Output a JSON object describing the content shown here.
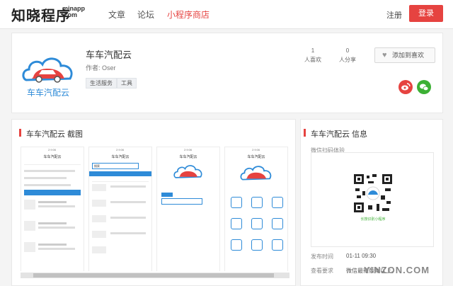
{
  "header": {
    "logo_cn": "知晓程序",
    "logo_en_1": "minapp",
    "logo_en_2": ".com",
    "nav": [
      "文章",
      "论坛",
      "小程序商店"
    ],
    "login": "注册",
    "register": "登录",
    "accent_color": "#e64340"
  },
  "app": {
    "name": "车车汽配云",
    "author": "作者: Oser",
    "tags": [
      "生活服务",
      "工具"
    ],
    "logo_text": "车车汽配云",
    "stats": [
      {
        "value": "1",
        "label": "人喜欢"
      },
      {
        "value": "0",
        "label": "人分享"
      }
    ],
    "like_button": "添加到喜欢",
    "share_icons": [
      "weibo-icon",
      "wechat-icon"
    ]
  },
  "screenshots": {
    "title": "车车汽配云 截图",
    "phone_title": "车车汽配云",
    "phone_time": "2:9:06",
    "search_placeholder": "搜索"
  },
  "info": {
    "title": "车车汽配云 信息",
    "qr_hint": "微信扫码体验",
    "qr_caption": "长按识别小程序",
    "publish_label": "发布时间",
    "publish_value": "01-11 09:30",
    "require_label": "查看要求",
    "require_value": "微信最新版本以上。"
  },
  "watermark": "YINZON.COM"
}
